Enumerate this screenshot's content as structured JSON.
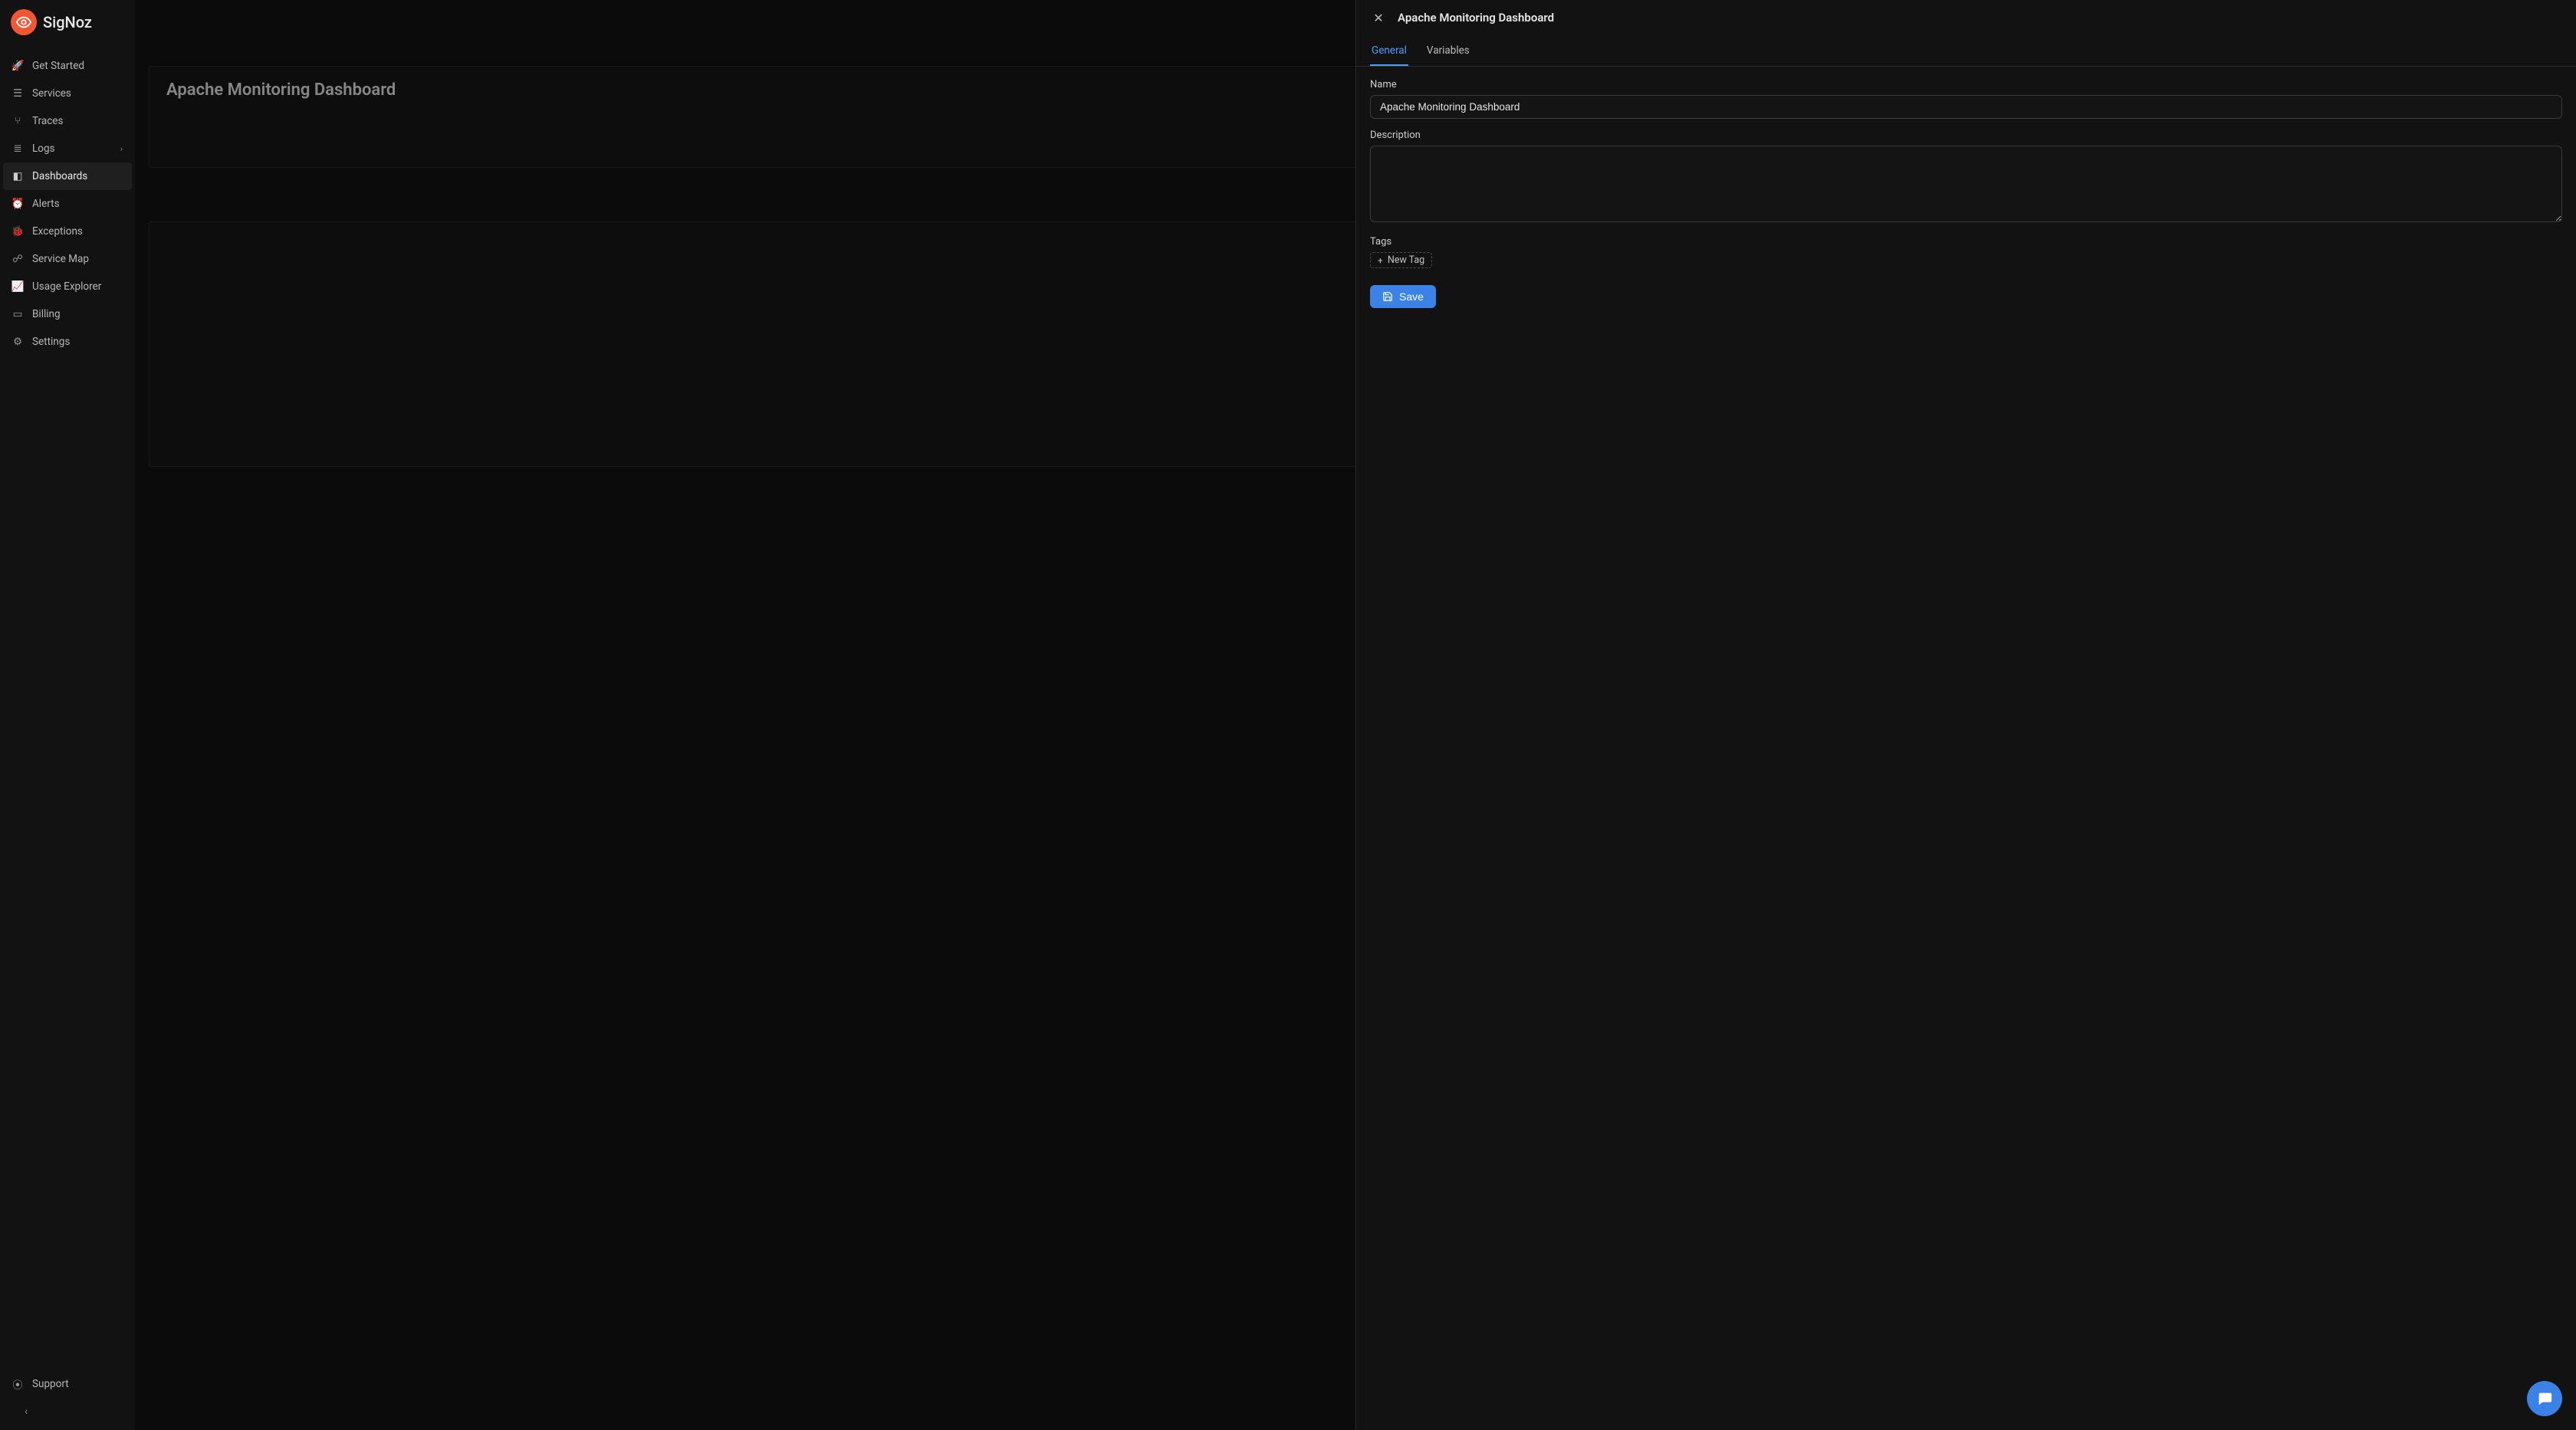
{
  "brand": {
    "name": "SigNoz"
  },
  "sidebar": {
    "items": [
      {
        "label": "Get Started",
        "icon": "rocket-icon"
      },
      {
        "label": "Services",
        "icon": "bars-icon"
      },
      {
        "label": "Traces",
        "icon": "branch-icon"
      },
      {
        "label": "Logs",
        "icon": "lines-icon",
        "expandable": true
      },
      {
        "label": "Dashboards",
        "icon": "dashboard-icon",
        "active": true
      },
      {
        "label": "Alerts",
        "icon": "bell-icon"
      },
      {
        "label": "Exceptions",
        "icon": "bug-icon"
      },
      {
        "label": "Service Map",
        "icon": "graph-icon"
      },
      {
        "label": "Usage Explorer",
        "icon": "chart-icon"
      },
      {
        "label": "Billing",
        "icon": "card-icon"
      },
      {
        "label": "Settings",
        "icon": "gear-icon"
      }
    ],
    "support": {
      "label": "Support",
      "icon": "lifebuoy-icon"
    }
  },
  "main": {
    "dashboard_title": "Apache Monitoring Dashboard"
  },
  "drawer": {
    "title": "Apache Monitoring Dashboard",
    "tabs": {
      "general": "General",
      "variables": "Variables"
    },
    "form": {
      "name_label": "Name",
      "name_value": "Apache Monitoring Dashboard",
      "description_label": "Description",
      "description_value": "",
      "tags_label": "Tags",
      "new_tag_label": "New Tag",
      "save_label": "Save"
    }
  }
}
